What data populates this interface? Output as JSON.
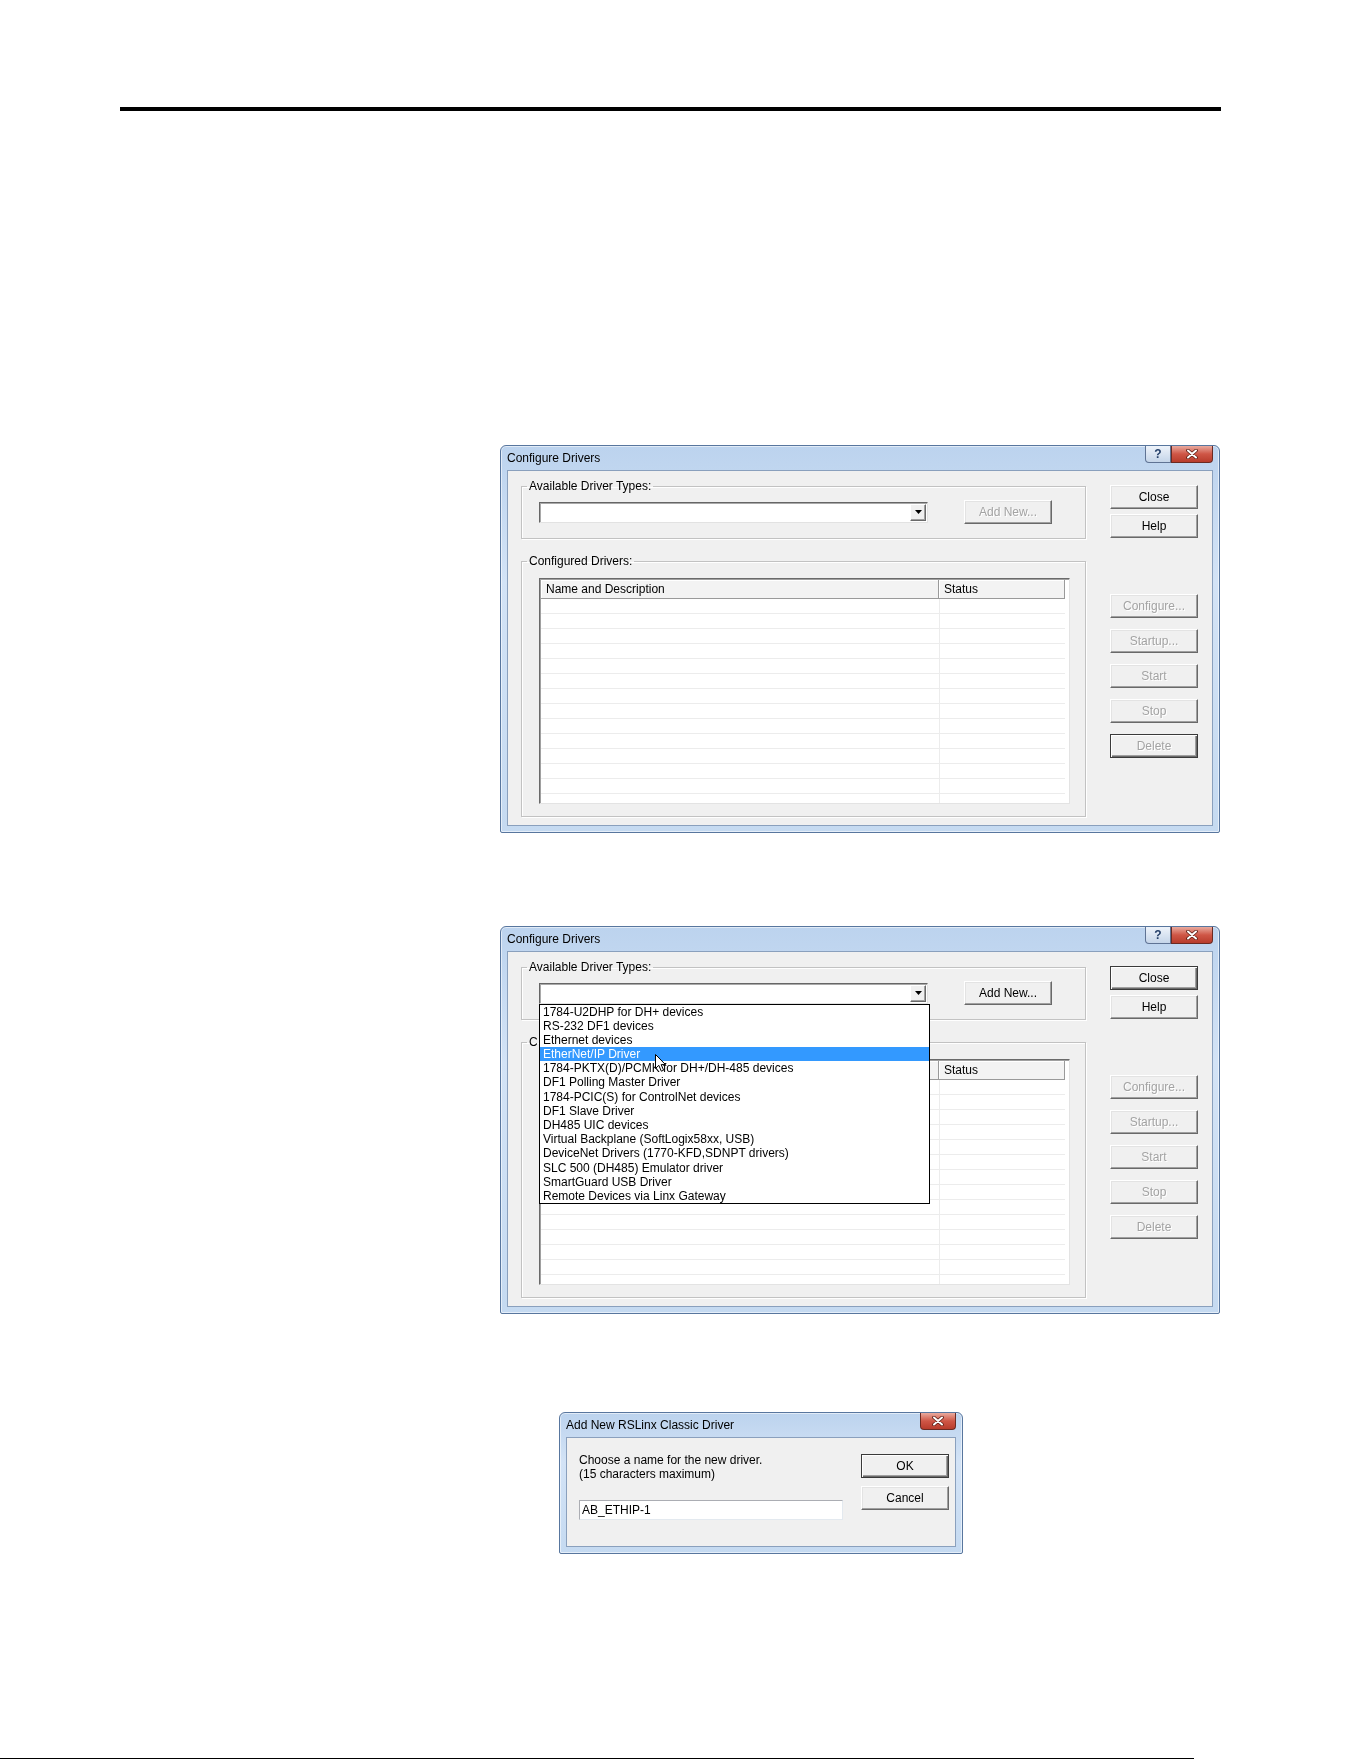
{
  "dialogs": [
    {
      "kind": "configure_drivers",
      "title": "Configure Drivers",
      "title_buttons": [
        {
          "kind": "help",
          "label": "?"
        },
        {
          "kind": "close"
        }
      ],
      "available_group": {
        "label": "Available Driver Types:",
        "add_button": {
          "label": "Add New...",
          "disabled": true,
          "default": false
        }
      },
      "configured_group": {
        "label": "Configured Drivers:",
        "table": {
          "name_header": "Name and Description",
          "status_header": "Status"
        }
      },
      "main_buttons": [
        {
          "label": "Close",
          "disabled": false,
          "default": false
        },
        {
          "label": "Help",
          "disabled": false,
          "default": false
        }
      ],
      "driver_buttons": [
        {
          "label": "Configure...",
          "disabled": true,
          "default": false
        },
        {
          "label": "Startup...",
          "disabled": true,
          "default": false
        },
        {
          "label": "Start",
          "disabled": true,
          "default": false
        },
        {
          "label": "Stop",
          "disabled": true,
          "default": false
        },
        {
          "label": "Delete",
          "disabled": true,
          "default": true
        }
      ]
    },
    {
      "kind": "configure_drivers",
      "title": "Configure Drivers",
      "title_buttons": [
        {
          "kind": "help",
          "label": "?"
        },
        {
          "kind": "close"
        }
      ],
      "available_group": {
        "label": "Available Driver Types:",
        "add_button": {
          "label": "Add New...",
          "disabled": false,
          "default": false
        },
        "dropdown": {
          "items": [
            {
              "label": "1784-U2DHP for DH+ devices",
              "selected": false
            },
            {
              "label": "RS-232 DF1 devices",
              "selected": false
            },
            {
              "label": "Ethernet devices",
              "selected": false
            },
            {
              "label": "EtherNet/IP Driver",
              "selected": true
            },
            {
              "label": "1784-PKTX(D)/PCMK for DH+/DH-485 devices",
              "selected": false
            },
            {
              "label": "DF1 Polling Master Driver",
              "selected": false
            },
            {
              "label": "1784-PCIC(S) for ControlNet devices",
              "selected": false
            },
            {
              "label": "DF1 Slave Driver",
              "selected": false
            },
            {
              "label": "DH485 UIC devices",
              "selected": false
            },
            {
              "label": "Virtual Backplane (SoftLogix58xx, USB)",
              "selected": false
            },
            {
              "label": "DeviceNet Drivers (1770-KFD,SDNPT drivers)",
              "selected": false
            },
            {
              "label": "SLC 500 (DH485) Emulator driver",
              "selected": false
            },
            {
              "label": "SmartGuard USB Driver",
              "selected": false
            },
            {
              "label": "Remote Devices via Linx Gateway",
              "selected": false
            }
          ]
        }
      },
      "configured_group": {
        "label": "C",
        "table": {
          "status_header": "Status"
        }
      },
      "main_buttons": [
        {
          "label": "Close",
          "disabled": false,
          "default": true
        },
        {
          "label": "Help",
          "disabled": false,
          "default": false
        }
      ],
      "driver_buttons": [
        {
          "label": "Configure...",
          "disabled": true,
          "default": false
        },
        {
          "label": "Startup...",
          "disabled": true,
          "default": false
        },
        {
          "label": "Start",
          "disabled": true,
          "default": false
        },
        {
          "label": "Stop",
          "disabled": true,
          "default": false
        },
        {
          "label": "Delete",
          "disabled": true,
          "default": false
        }
      ]
    },
    {
      "kind": "add_driver",
      "title": "Add New RSLinx Classic Driver",
      "title_buttons": [
        {
          "kind": "close"
        }
      ],
      "prompt": "Choose a name for the new driver.",
      "limit_note": "(15 characters maximum)",
      "name_field": {
        "value": "AB_ETHIP-1"
      },
      "buttons": [
        {
          "label": "OK",
          "disabled": false,
          "default": true
        },
        {
          "label": "Cancel",
          "disabled": false,
          "default": false
        }
      ]
    }
  ]
}
